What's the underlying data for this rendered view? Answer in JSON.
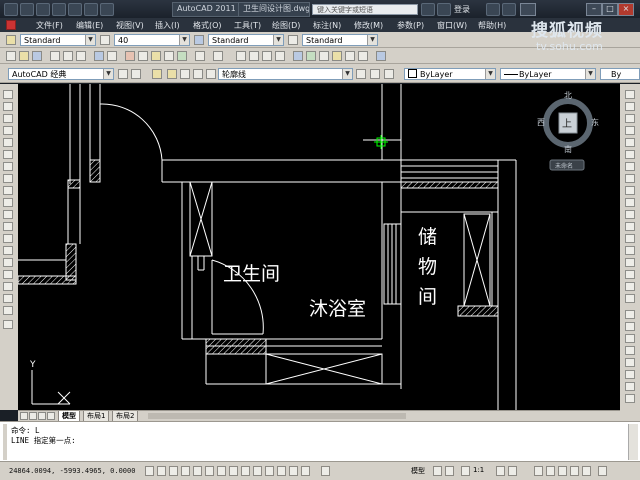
{
  "window": {
    "app_tab": "AutoCAD 2011",
    "file_tab": "卫生间设计图.dwg",
    "search_placeholder": "键入关键字或短语",
    "login_label": "登录",
    "controls": [
      "–",
      "□",
      "×"
    ]
  },
  "watermark": {
    "brand": "搜狐视频",
    "url": "tv.sohu.com"
  },
  "menu": [
    "文件(F)",
    "编辑(E)",
    "视图(V)",
    "插入(I)",
    "格式(O)",
    "工具(T)",
    "绘图(D)",
    "标注(N)",
    "修改(M)",
    "参数(P)",
    "窗口(W)",
    "帮助(H)"
  ],
  "styles_toolbar": {
    "text_style": "Standard",
    "text_height": "40",
    "dim_style": "Standard",
    "table_style": "Standard"
  },
  "workspace": {
    "name": "AutoCAD 经典"
  },
  "layers": {
    "current": "轮廓线"
  },
  "properties": {
    "color": "ByLayer",
    "linetype": "ByLayer",
    "lineweight": "By"
  },
  "viewcube": {
    "north": "北",
    "south": "南",
    "east": "东",
    "west": "西",
    "face": "上",
    "wcs": "未命名"
  },
  "drawing": {
    "label_bathroom": "卫生间",
    "label_shower": "沐浴室",
    "label_storage_1": "储",
    "label_storage_2": "物",
    "label_storage_3": "间",
    "ucs_y": "Y"
  },
  "layout_tabs": [
    "模型",
    "布局1",
    "布局2"
  ],
  "command": {
    "line1": "命令: L",
    "line2": "LINE 指定第一点:"
  },
  "status": {
    "coords": "24864.0094, -5993.4965, 0.0000",
    "model_label": "模型",
    "scale": "1:1"
  },
  "colors": {
    "canvas": "#000000",
    "lines": "#ffffff",
    "wall_hatch": "#ffffff",
    "cursor": "#00ff00",
    "ui": "#d4d0c8"
  }
}
